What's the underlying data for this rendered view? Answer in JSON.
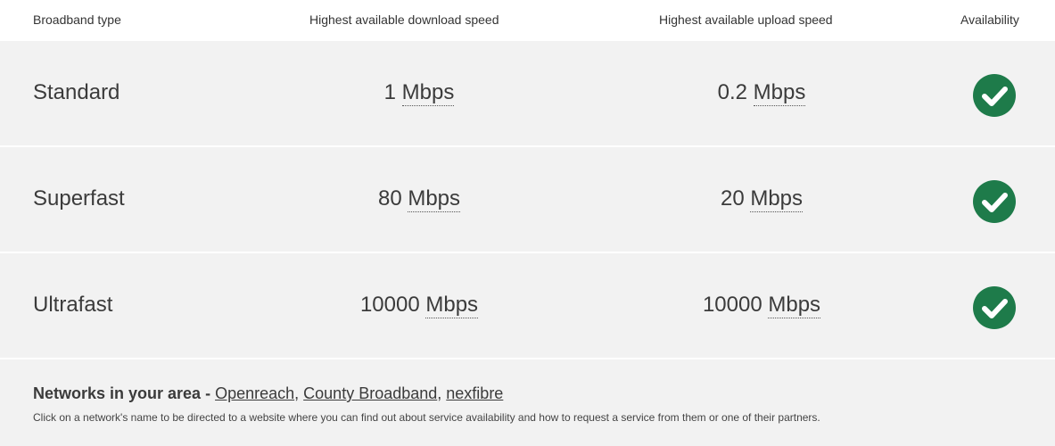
{
  "header": {
    "type": "Broadband type",
    "download": "Highest available download speed",
    "upload": "Highest available upload speed",
    "availability": "Availability"
  },
  "rows": [
    {
      "type": "Standard",
      "download_value": "1",
      "download_unit": "Mbps",
      "upload_value": "0.2",
      "upload_unit": "Mbps",
      "available_icon": "check-circle-icon"
    },
    {
      "type": "Superfast",
      "download_value": "80",
      "download_unit": "Mbps",
      "upload_value": "20",
      "upload_unit": "Mbps",
      "available_icon": "check-circle-icon"
    },
    {
      "type": "Ultrafast",
      "download_value": "10000",
      "download_unit": "Mbps",
      "upload_value": "10000",
      "upload_unit": "Mbps",
      "available_icon": "check-circle-icon"
    }
  ],
  "networks": {
    "title": "Networks in your area - ",
    "links": [
      "Openreach",
      "County Broadband",
      "nexfibre"
    ],
    "separator": ", ",
    "note": "Click on a network's name to be directed to a website where you can find out about service availability and how to request a service from them or one of their partners."
  },
  "colors": {
    "row_bg": "#f2f2f2",
    "check_green": "#1e7b4a",
    "text": "#3b3b3b"
  }
}
